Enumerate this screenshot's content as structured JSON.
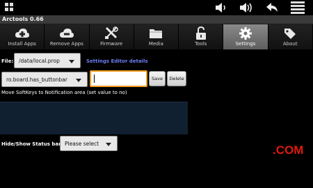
{
  "app": {
    "title": "Arctools 0.66"
  },
  "tabs": [
    {
      "label": "Install Apps",
      "icon": "install-apps-icon"
    },
    {
      "label": "Remove Apps",
      "icon": "remove-apps-icon"
    },
    {
      "label": "Firmware",
      "icon": "firmware-tools-icon"
    },
    {
      "label": "Media",
      "icon": "folder-icon"
    },
    {
      "label": "Tools",
      "icon": "unlock-icon"
    },
    {
      "label": "Settings",
      "icon": "gear-icon",
      "active": true
    },
    {
      "label": "About",
      "icon": "tag-icon"
    }
  ],
  "file": {
    "label": "File:",
    "selected": "/data/local.prop",
    "link": "Settings Editor details"
  },
  "property": {
    "selected": "ro.board.has_buttonbar",
    "value": "",
    "save_label": "Save",
    "delete_label": "Delete",
    "description": "Move SoftKeys to Notification area (set value to no)"
  },
  "statusbar_setting": {
    "label": "Hide/Show Status bar:",
    "selected": "Please select"
  },
  "watermark": ".COM",
  "colors": {
    "accent_orange": "#f29b1d",
    "link_blue": "#6d7df0",
    "panel_navy": "#102030",
    "watermark_red": "#e01a0d"
  }
}
